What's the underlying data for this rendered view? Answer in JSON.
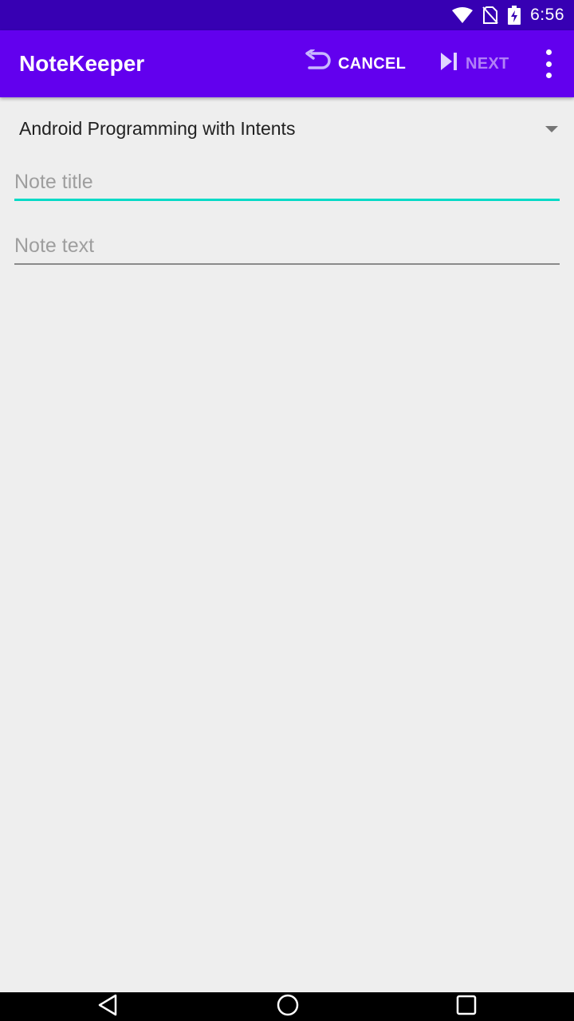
{
  "status_bar": {
    "time": "6:56",
    "icons": [
      "wifi-icon",
      "no-sim-icon",
      "battery-charging-icon"
    ]
  },
  "app_bar": {
    "title": "NoteKeeper",
    "actions": {
      "cancel": {
        "label": "CANCEL",
        "icon": "undo-icon"
      },
      "next": {
        "label": "NEXT",
        "icon": "skip-next-icon",
        "enabled": false
      },
      "overflow": {
        "icon": "more-vert-icon"
      }
    }
  },
  "form": {
    "course_spinner": {
      "selected": "Android Programming with Intents"
    },
    "note_title": {
      "value": "",
      "placeholder": "Note title"
    },
    "note_text": {
      "value": "",
      "placeholder": "Note text"
    }
  },
  "colors": {
    "primary": "#6200ee",
    "primary_dark": "#3700b3",
    "accent": "#03dac6",
    "background": "#eeeeee"
  },
  "nav_bar": {
    "buttons": [
      "back-icon",
      "home-icon",
      "recents-icon"
    ]
  }
}
